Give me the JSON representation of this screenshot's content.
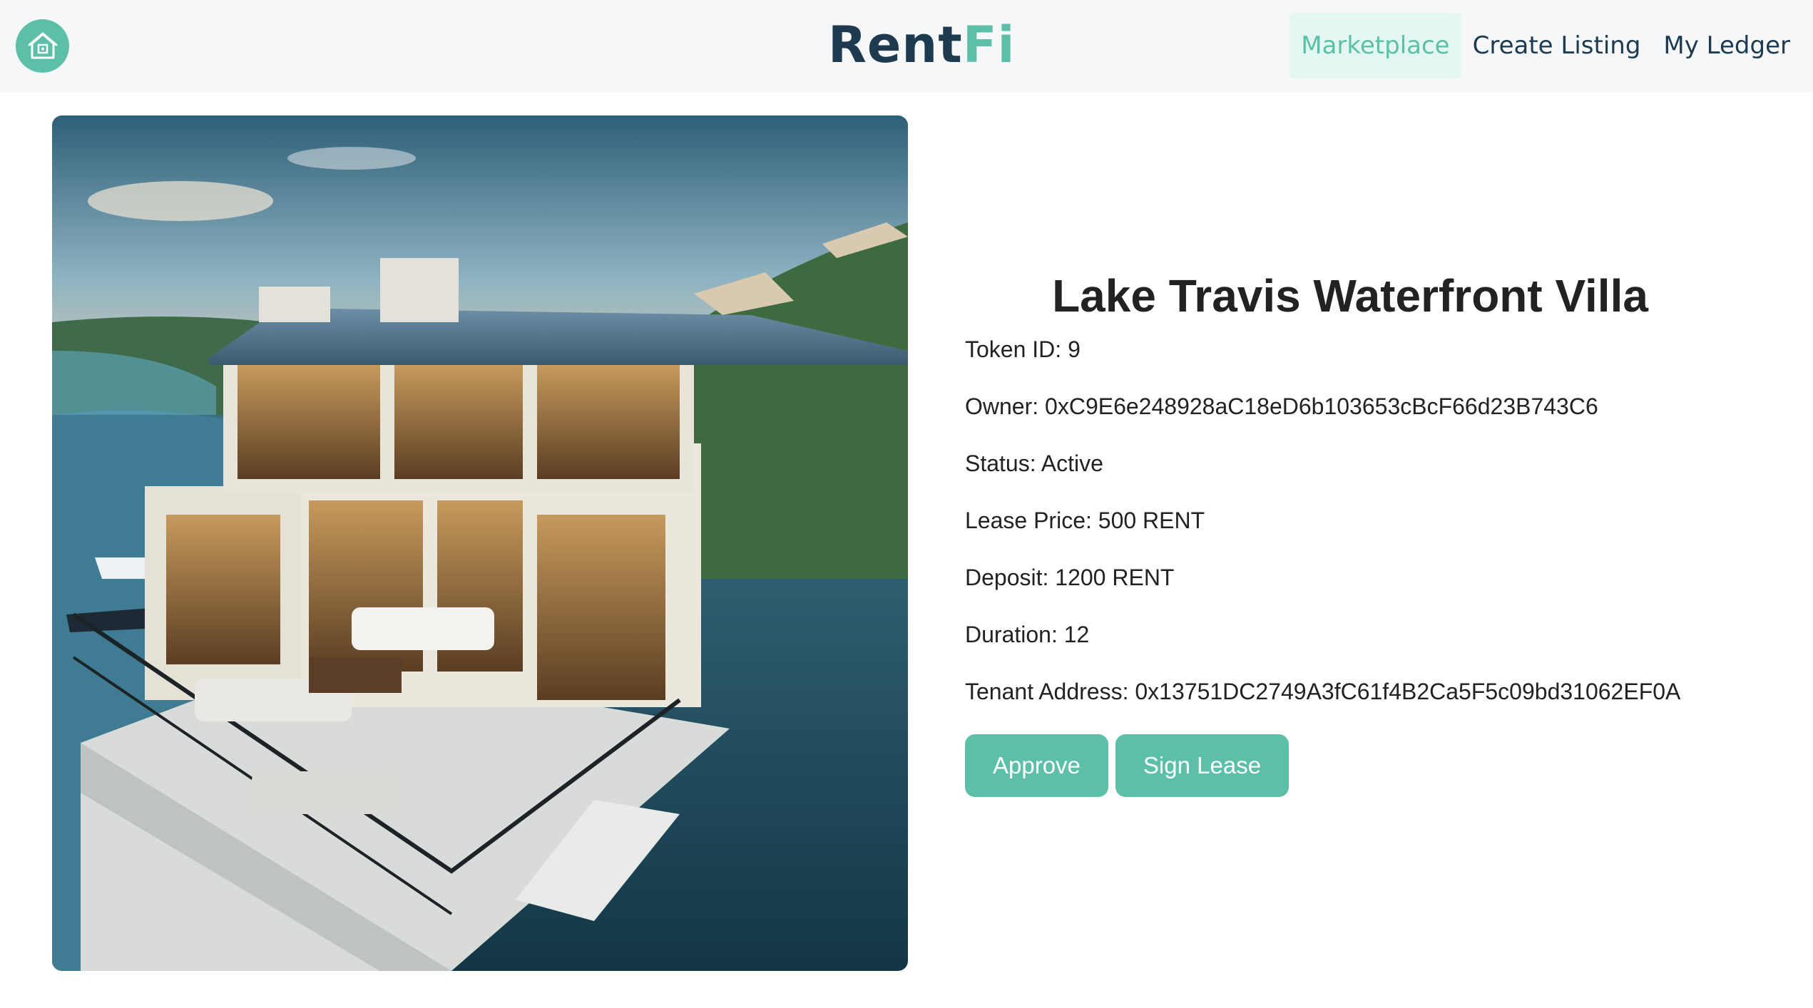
{
  "nav": {
    "logo_icon": "house-logo-icon",
    "brand_part1": "Rent",
    "brand_part2": "Fi",
    "links": [
      {
        "label": "Marketplace",
        "active": true
      },
      {
        "label": "Create Listing",
        "active": false
      },
      {
        "label": "My Ledger",
        "active": false
      }
    ]
  },
  "listing": {
    "image": "villa-photo",
    "title": "Lake Travis Waterfront Villa",
    "token_id": "Token ID: 9",
    "owner": "Owner: 0xC9E6e248928aC18eD6b103653cBcF66d23B743C6",
    "status": "Status: Active",
    "lease_price": "Lease Price: 500 RENT",
    "deposit": "Deposit: 1200 RENT",
    "duration": "Duration: 12",
    "tenant": "Tenant Address: 0x13751DC2749A3fC61f4B2Ca5F5c09bd31062EF0A"
  },
  "actions": {
    "approve_label": "Approve",
    "sign_label": "Sign Lease"
  },
  "colors": {
    "accent": "#5cbfa8",
    "brand_dark": "#1e3a4f",
    "nav_bg": "#f6f7f8"
  }
}
